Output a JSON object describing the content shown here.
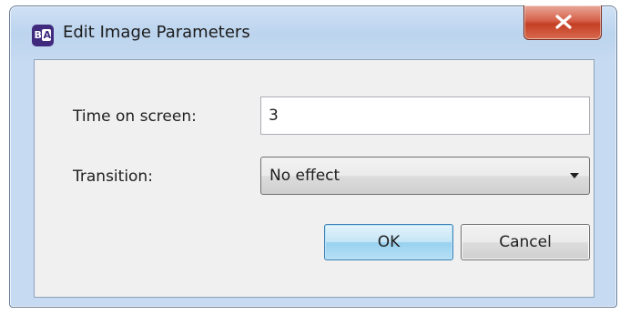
{
  "window": {
    "title": "Edit Image Parameters",
    "app_icon_text_b": "B",
    "app_icon_text_a": "A"
  },
  "form": {
    "time_label": "Time on screen:",
    "time_value": "3",
    "transition_label": "Transition:",
    "transition_value": "No effect"
  },
  "buttons": {
    "ok_label": "OK",
    "cancel_label": "Cancel"
  },
  "icons": {
    "close": "close-icon",
    "dropdown": "dropdown-arrow-icon",
    "app": "app-logo-icon"
  },
  "colors": {
    "titlebar": "#c6daf1",
    "close_button": "#c43f24",
    "default_button": "#98d1ef",
    "app_icon": "#3f2a7e"
  }
}
